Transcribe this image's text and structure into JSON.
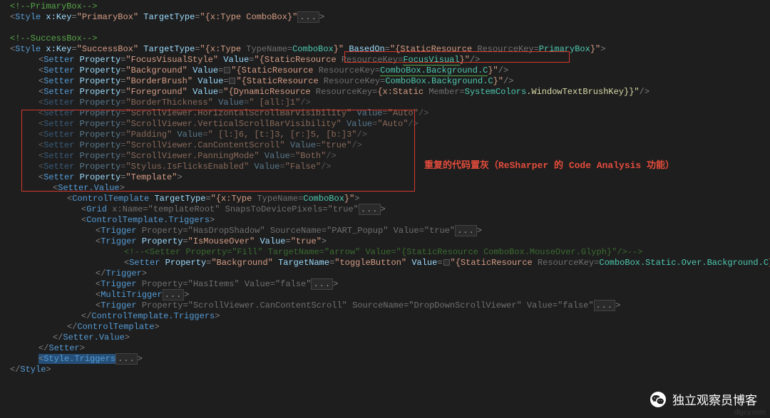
{
  "comments": {
    "primaryBox": "<!--PrimaryBox-->",
    "successBox": "<!--SuccessBox-->",
    "inlineSetter": "<!--<Setter Property=\"Fill\" TargetName=\"arrow\" Value=\"{StaticResource ComboBox.MouseOver.Glyph}\"/>-->"
  },
  "style1": {
    "open1": "<",
    "tag": "Style",
    "sp": " ",
    "attrKey": "x:Key",
    "valKey": "\"PrimaryBox\"",
    "attrTT": "TargetType",
    "valTT": "\"{x:Type ComboBox}\"",
    "dots": "...",
    "close": ">"
  },
  "style2": {
    "tag": "Style",
    "attrKey": "x:Key",
    "valKey": "\"SuccessBox\"",
    "attrTT": "TargetType",
    "valTTPrefix": "\"{x:Type ",
    "typeNameHint": "TypeName=",
    "cb": "ComboBox",
    "valTTSuffix": "}\"",
    "attrBO": "BasedOn",
    "valBOPrefix": "\"{StaticResource ",
    "rkHint": "ResourceKey=",
    "pb": "PrimaryBox",
    "valBOSuffix": "}\""
  },
  "setters": {
    "tag": "Setter",
    "prop": "Property",
    "val": "Value",
    "fvs": "\"FocusVisualStyle\"",
    "fvsVal1": "\"{StaticResource ",
    "fvsVal2": "FocusVisual",
    "fvsVal3": "}\"",
    "bg": "\"Background\"",
    "bgVal1": "\"{StaticResource ",
    "bgVal2": "ComboBox.Background.C",
    "bgVal3": "}\"",
    "bb": "\"BorderBrush\"",
    "fg": "\"Foreground\"",
    "fgVal1": "\"{DynamicResource ",
    "fgMem": "Member=",
    "fgVal2": "{x:Static ",
    "fgVal3": "SystemColors",
    "fgVal4": ".WindowTextBrushKey}}\"",
    "bt": "\"BorderThickness\"",
    "btVal": "\" [all:]1\"",
    "hsb": "\"ScrollViewer.HorizontalScrollBarVisibility\"",
    "auto": "\"Auto\"",
    "vsb": "\"ScrollViewer.VerticalScrollBarVisibility\"",
    "pad": "\"Padding\"",
    "padVal": "\" [l:]6, [t:]3, [r:]5, [b:]3\"",
    "ccs": "\"ScrollViewer.CanContentScroll\"",
    "true": "\"true\"",
    "pm": "\"ScrollViewer.PanningMode\"",
    "both": "\"Both\"",
    "fe": "\"Stylus.IsFlicksEnabled\"",
    "false": "\"False\"",
    "tpl": "\"Template\""
  },
  "template": {
    "sv": "Setter.Value",
    "ct": "ControlTemplate",
    "ctTT": "TargetType",
    "ctVal1": "\"{x:Type ",
    "ctVal2": "ComboBox",
    "ctVal3": "}\"",
    "grid": "Grid",
    "gridAttr1": "x:Name=\"templateRoot\"",
    "gridAttr2": "SnapsToDevicePixels=\"true\"",
    "ctt": "ControlTemplate.Triggers",
    "trigger": "Trigger",
    "t1": "Property=\"HasDropShadow\" SourceName=\"PART_Popup\" Value=\"true\"",
    "t2prop": "Property",
    "t2propv": "\"IsMouseOver\"",
    "t2val": "Value",
    "t2valv": "\"true\"",
    "innerSet": "Setter",
    "innerProp": "Property",
    "innerPropV": "\"Background\"",
    "innerTN": "TargetName",
    "innerTNV": "\"toggleButton\"",
    "innerVal": "Value",
    "innerValPre": "\"{StaticResource ",
    "innerValMid": "ComboBox.Static.Over.Background.C",
    "innerValSuf": "}\"",
    "t3": "Property=\"HasItems\" Value=\"false\"",
    "mt": "MultiTrigger",
    "t4": "Property=\"ScrollViewer.CanContentScroll\" SourceName=\"DropDownScrollViewer\" Value=\"false\""
  },
  "closeTags": {
    "trigger": "Trigger",
    "ctt": "ControlTemplate.Triggers",
    "ct": "ControlTemplate",
    "sv": "Setter.Value",
    "setter": "Setter",
    "st": "Style.Triggers",
    "style": "Style"
  },
  "annotation": "重复的代码置灰（ReSharper 的 Code Analysis 功能）",
  "watermark": "独立观察员博客",
  "wm2": "dlgcy.com"
}
